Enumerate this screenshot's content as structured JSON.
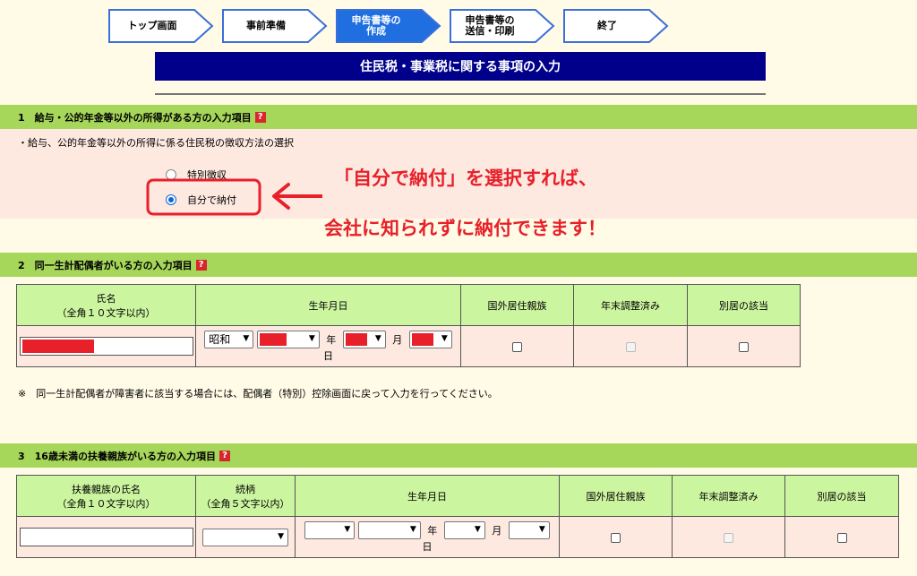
{
  "steps": [
    {
      "label": "トップ画面",
      "active": false
    },
    {
      "label": "事前準備",
      "active": false
    },
    {
      "label": "申告書等の\n作成",
      "active": true
    },
    {
      "label": "申告書等の\n送信・印刷",
      "active": false
    },
    {
      "label": "終了",
      "active": false
    }
  ],
  "page_title": "住民税・事業税に関する事項の入力",
  "section1": {
    "title": "1　給与・公的年金等以外の所得がある方の入力項目",
    "help_icon": "?",
    "description": "・給与、公的年金等以外の所得に係る住民税の徴収方法の選択",
    "options": [
      {
        "label": "特別徴収",
        "selected": false
      },
      {
        "label": "自分で納付",
        "selected": true
      }
    ],
    "callout_line1": "「自分で納付」を選択すれば、",
    "callout_line2": "会社に知られずに納付できます！"
  },
  "section2": {
    "title": "2　同一生計配偶者がいる方の入力項目",
    "help_icon": "?",
    "headers": {
      "name": "氏名",
      "name_note": "（全角１０文字以内）",
      "birth": "生年月日",
      "overseas": "国外居住親族",
      "year_end": "年末調整済み",
      "separate": "別居の該当"
    },
    "era_value": "昭和",
    "unit_year": "年",
    "unit_month": "月",
    "unit_day": "日",
    "note": "※　同一生計配偶者が障害者に該当する場合には、配偶者（特別）控除画面に戻って入力を行ってください。"
  },
  "section3": {
    "title": "3　16歳未満の扶養親族がいる方の入力項目",
    "help_icon": "?",
    "headers": {
      "name": "扶養親族の氏名",
      "name_note": "（全角１０文字以内）",
      "relation": "続柄",
      "relation_note": "（全角５文字以内）",
      "birth": "生年月日",
      "overseas": "国外居住親族",
      "year_end": "年末調整済み",
      "separate": "別居の該当"
    },
    "unit_year": "年",
    "unit_month": "月",
    "unit_day": "日"
  },
  "colors": {
    "accent": "#00008b",
    "section_header": "#a6d65a",
    "callout": "#e8202a"
  }
}
